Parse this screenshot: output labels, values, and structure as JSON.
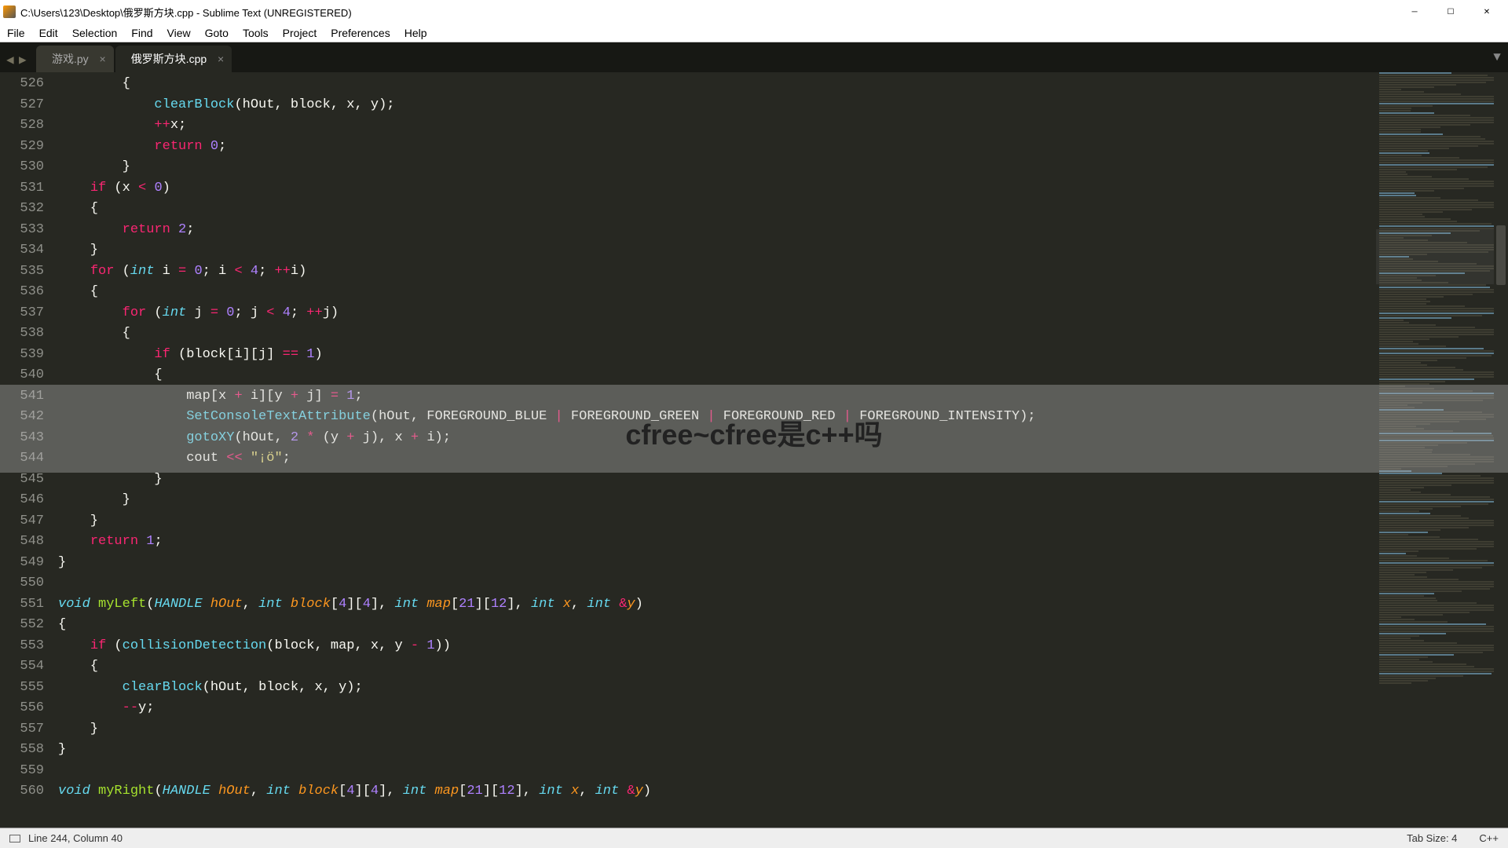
{
  "title": "C:\\Users\\123\\Desktop\\俄罗斯方块.cpp - Sublime Text (UNREGISTERED)",
  "menu": [
    "File",
    "Edit",
    "Selection",
    "Find",
    "View",
    "Goto",
    "Tools",
    "Project",
    "Preferences",
    "Help"
  ],
  "tabs": [
    {
      "label": "游戏.py",
      "active": false
    },
    {
      "label": "俄罗斯方块.cpp",
      "active": true
    }
  ],
  "line_start": 526,
  "line_end": 560,
  "overlay": "cfree~cfree是c++吗",
  "status": {
    "pos": "Line 244, Column 40",
    "tabsize": "Tab Size: 4",
    "syntax": "C++"
  }
}
